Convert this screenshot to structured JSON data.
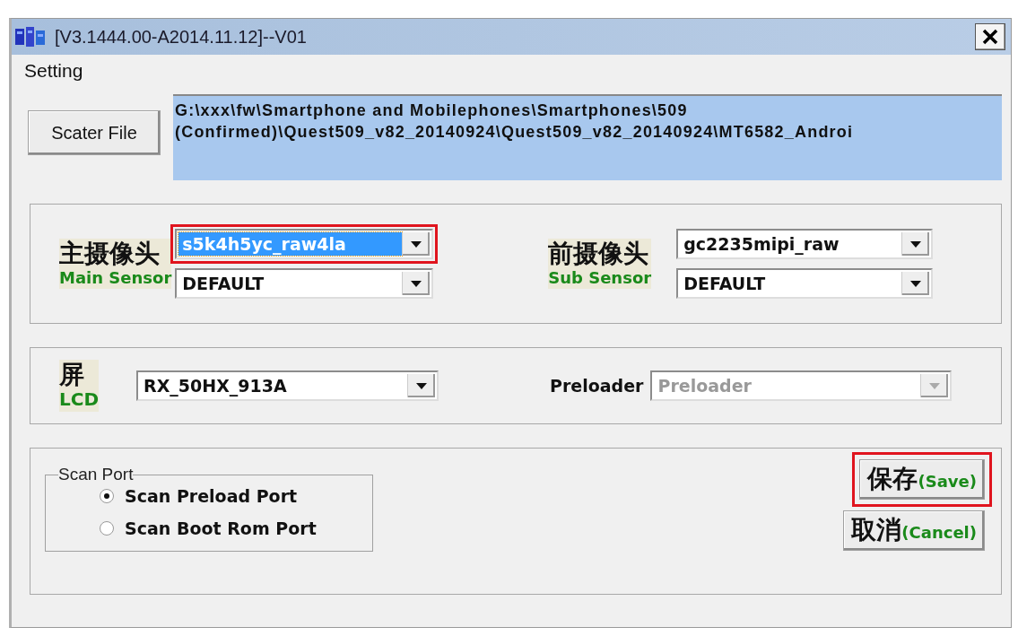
{
  "window": {
    "title": "[V3.1444.00-A2014.11.12]--V01"
  },
  "menu": [
    {
      "label": "Setting"
    }
  ],
  "scatter": {
    "button": "Scater File",
    "path_lines": [
      "G:\\xxx\\fw\\Smartphone and Mobilephones\\Smartphones\\509",
      "(Confirmed)\\Quest509_v82_20140924\\Quest509_v82_20140924\\MT6582_Androi"
    ]
  },
  "sensors": [
    {
      "cn": "主摄像头",
      "en": "Main Sensor",
      "selects": [
        {
          "value": "s5k4h5yc_raw4la",
          "selected": true,
          "highlighted": true
        },
        {
          "value": "DEFAULT",
          "selected": false,
          "highlighted": false
        }
      ]
    },
    {
      "cn": "前摄像头",
      "en": "Sub Sensor",
      "selects": [
        {
          "value": "gc2235mipi_raw",
          "selected": false,
          "highlighted": false
        },
        {
          "value": "DEFAULT",
          "selected": false,
          "highlighted": false
        }
      ]
    }
  ],
  "lcd": {
    "cn": "屏",
    "en": "LCD",
    "value": "RX_50HX_913A"
  },
  "preloader": {
    "label": "Preloader",
    "value": "Preloader",
    "disabled": true
  },
  "scan_port": {
    "title": "Scan Port",
    "options": [
      {
        "label": "Scan Preload Port",
        "selected": true
      },
      {
        "label": "Scan Boot Rom Port",
        "selected": false
      }
    ]
  },
  "buttons": [
    {
      "cn": "保存",
      "en": "(Save)",
      "highlighted": true
    },
    {
      "cn": "取消",
      "en": "(Cancel)",
      "highlighted": false
    }
  ]
}
